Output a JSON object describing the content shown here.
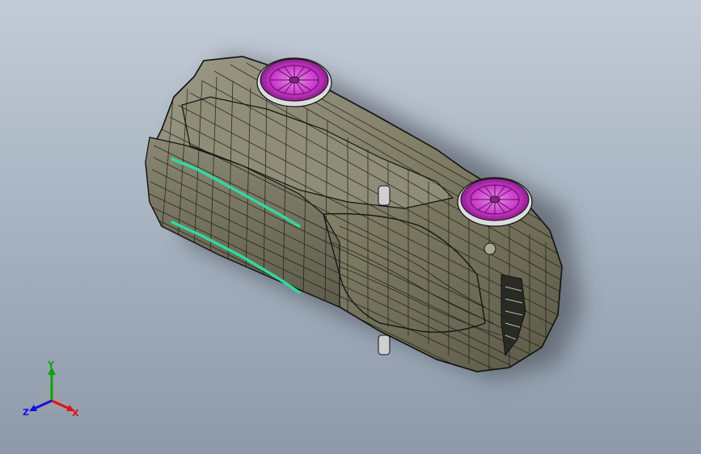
{
  "viewport": {
    "name": "cad-graphics-area",
    "background_top": "#c3cbd6",
    "background_bottom": "#8e9aaa"
  },
  "model": {
    "name": "car-body-shell-surface-model",
    "body_color": "#807d66",
    "wheel_color": "#c834c8",
    "trim_color": "#30d9a0",
    "components": [
      "body-shell",
      "front-wheel",
      "rear-wheel",
      "side-trim-strips",
      "grille",
      "mirror-tabs"
    ]
  },
  "triad": {
    "x_label": "X",
    "y_label": "Y",
    "z_label": "Z",
    "x_color": "#e01010",
    "y_color": "#10a010",
    "z_color": "#1010e0"
  }
}
